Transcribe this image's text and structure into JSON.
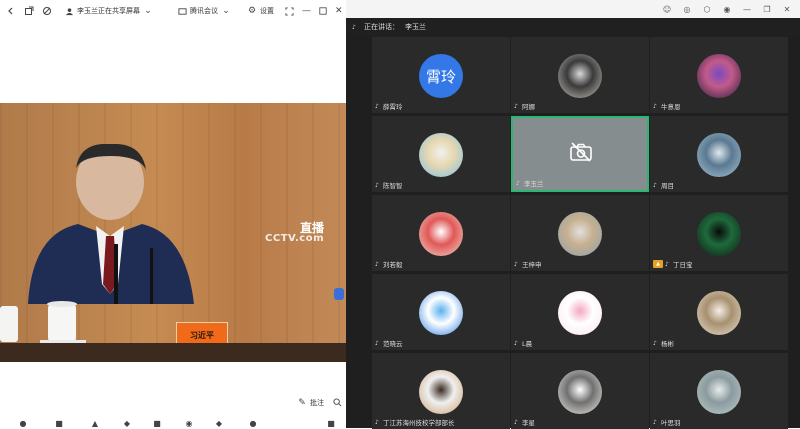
{
  "left_window": {
    "title": "李玉兰正在共享屏幕",
    "participant_button": "腾讯会议",
    "settings_label": "设置",
    "annotation_label": "批注"
  },
  "broadcast": {
    "live_label": "直播",
    "channel_label": "CCTV.com",
    "nameplate": "习近平"
  },
  "right_window": {
    "speaking_label": "正在讲话：",
    "speaking_name": "李玉兰"
  },
  "participants": [
    {
      "name": "薛霄玲",
      "avatar_text": "霄玲",
      "avatar_kind": "text"
    },
    {
      "name": "阿娜",
      "avatar_kind": "photo",
      "colors": [
        "#c7c2bb",
        "#3a3a3a",
        "#d8d8d8"
      ]
    },
    {
      "name": "牛意恩",
      "avatar_kind": "photo",
      "colors": [
        "#2b1b3a",
        "#c25b8a",
        "#7a4ac0"
      ]
    },
    {
      "name": "陈智智",
      "avatar_kind": "photo",
      "colors": [
        "#79c0e8",
        "#e8d8b0",
        "#f0f0f0"
      ]
    },
    {
      "name": "李玉兰",
      "avatar_kind": "cam_off",
      "selected": true
    },
    {
      "name": "周目",
      "avatar_kind": "photo",
      "colors": [
        "#a8c6d6",
        "#5a7890",
        "#dfe8ee"
      ]
    },
    {
      "name": "刘若毅",
      "avatar_kind": "photo",
      "colors": [
        "#f0d8c8",
        "#e05858",
        "#ffffff"
      ]
    },
    {
      "name": "王梓申",
      "avatar_kind": "photo",
      "colors": [
        "#8aa0b0",
        "#c8b090",
        "#e0e0e0"
      ]
    },
    {
      "name": "丁日宝",
      "avatar_kind": "photo",
      "colors": [
        "#0c1c14",
        "#1f6a3c",
        "#0a0a0a"
      ],
      "host": true
    },
    {
      "name": "范晓云",
      "avatar_kind": "photo",
      "colors": [
        "#2a7fe0",
        "#ffffff",
        "#5ab0f0"
      ]
    },
    {
      "name": "L晨",
      "avatar_kind": "photo",
      "colors": [
        "#fde4ec",
        "#ffffff",
        "#f4a8c0"
      ]
    },
    {
      "name": "杨彬",
      "avatar_kind": "photo",
      "colors": [
        "#e8e0d0",
        "#a89070",
        "#f4efe6"
      ]
    },
    {
      "name": "丁江苏海州技校学部部长",
      "avatar_kind": "photo",
      "colors": [
        "#c8a070",
        "#f0f0f0",
        "#3a2a20"
      ]
    },
    {
      "name": "李星",
      "avatar_kind": "photo",
      "colors": [
        "#f0ece8",
        "#707070",
        "#ffffff"
      ]
    },
    {
      "name": "叶思羽",
      "avatar_kind": "photo",
      "colors": [
        "#c0d0c8",
        "#8a9aa0",
        "#e8ece8"
      ]
    }
  ],
  "icons": {
    "titlebar": [
      "back-icon",
      "share-icon",
      "link-icon",
      "participants-icon",
      "settings-icon",
      "fullscreen-icon",
      "minimize-icon",
      "maximize-icon",
      "close-icon"
    ]
  },
  "colors": {
    "tile_bg": "#2a2a2a",
    "selected_border": "#2bb673",
    "avatar_blue": "#3478e8"
  }
}
